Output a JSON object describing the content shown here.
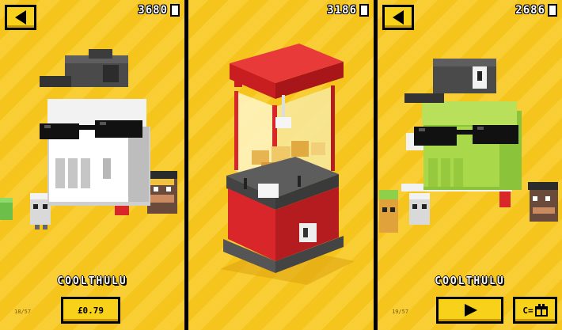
{
  "left_panel": {
    "coins": "3680",
    "character_name": "COOLTHULU",
    "counter": "18/57",
    "price_label": "£0.79"
  },
  "middle_panel": {
    "coins": "3186"
  },
  "right_panel": {
    "coins": "2686",
    "character_name": "COOLTHULU",
    "counter": "19/57",
    "gift_label": "C="
  },
  "icons": {
    "back": "back-arrow-icon",
    "coin": "coin-icon",
    "play": "play-icon",
    "gift": "gift-icon"
  },
  "colors": {
    "background": "#f6c51d",
    "button": "#f8d21a",
    "machine_red": "#d8262a",
    "character_green": "#a9d84a",
    "character_white": "#e8e8e8"
  }
}
